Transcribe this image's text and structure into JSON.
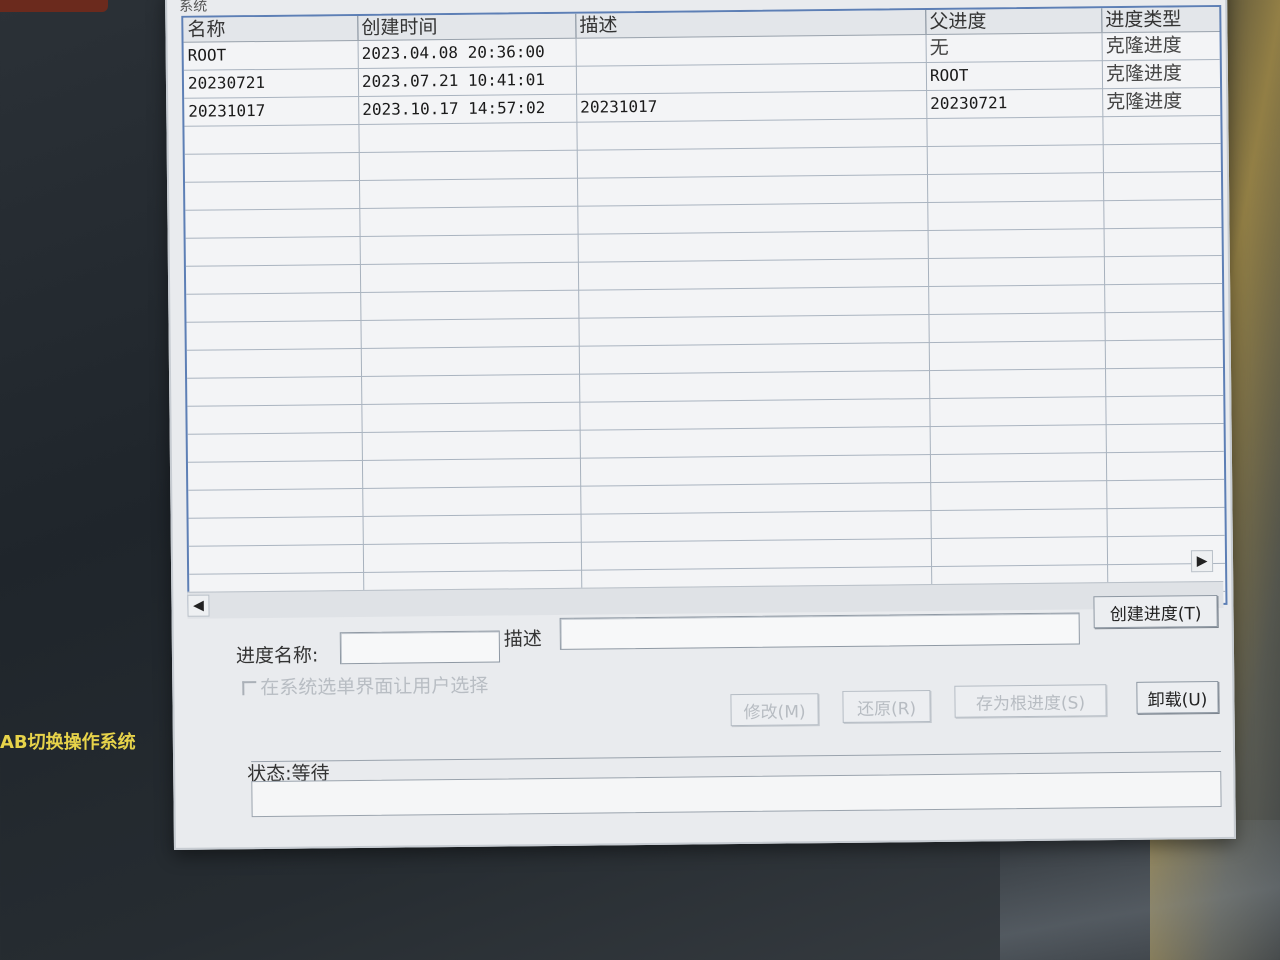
{
  "desktop": {
    "label": "AB切换操作系统"
  },
  "window": {
    "title": "系统"
  },
  "table": {
    "columns": [
      "名称",
      "创建时间",
      "描述",
      "父进度",
      "进度类型"
    ],
    "rows": [
      {
        "name": "ROOT",
        "created": "2023.04.08 20:36:00",
        "desc": "",
        "parent": "无",
        "type": "克隆进度"
      },
      {
        "name": "20230721",
        "created": "2023.07.21 10:41:01",
        "desc": "",
        "parent": "ROOT",
        "type": "克隆进度"
      },
      {
        "name": "20231017",
        "created": "2023.10.17 14:57:02",
        "desc": "20231017",
        "parent": "20230721",
        "type": "克隆进度"
      }
    ]
  },
  "scroll": {
    "left_glyph": "◀",
    "right_glyph": "▶"
  },
  "form": {
    "name_label": "进度名称:",
    "name_value": "",
    "desc_label": "描述",
    "desc_value": "",
    "create_button": "创建进度(T)",
    "checkbox_label": "在系统选单界面让用户选择"
  },
  "actions": {
    "modify": "修改(M)",
    "restore": "还原(R)",
    "set_root": "存为根进度(S)",
    "uninstall": "卸载(U)"
  },
  "status": {
    "label": "状态:等待",
    "message": ""
  }
}
